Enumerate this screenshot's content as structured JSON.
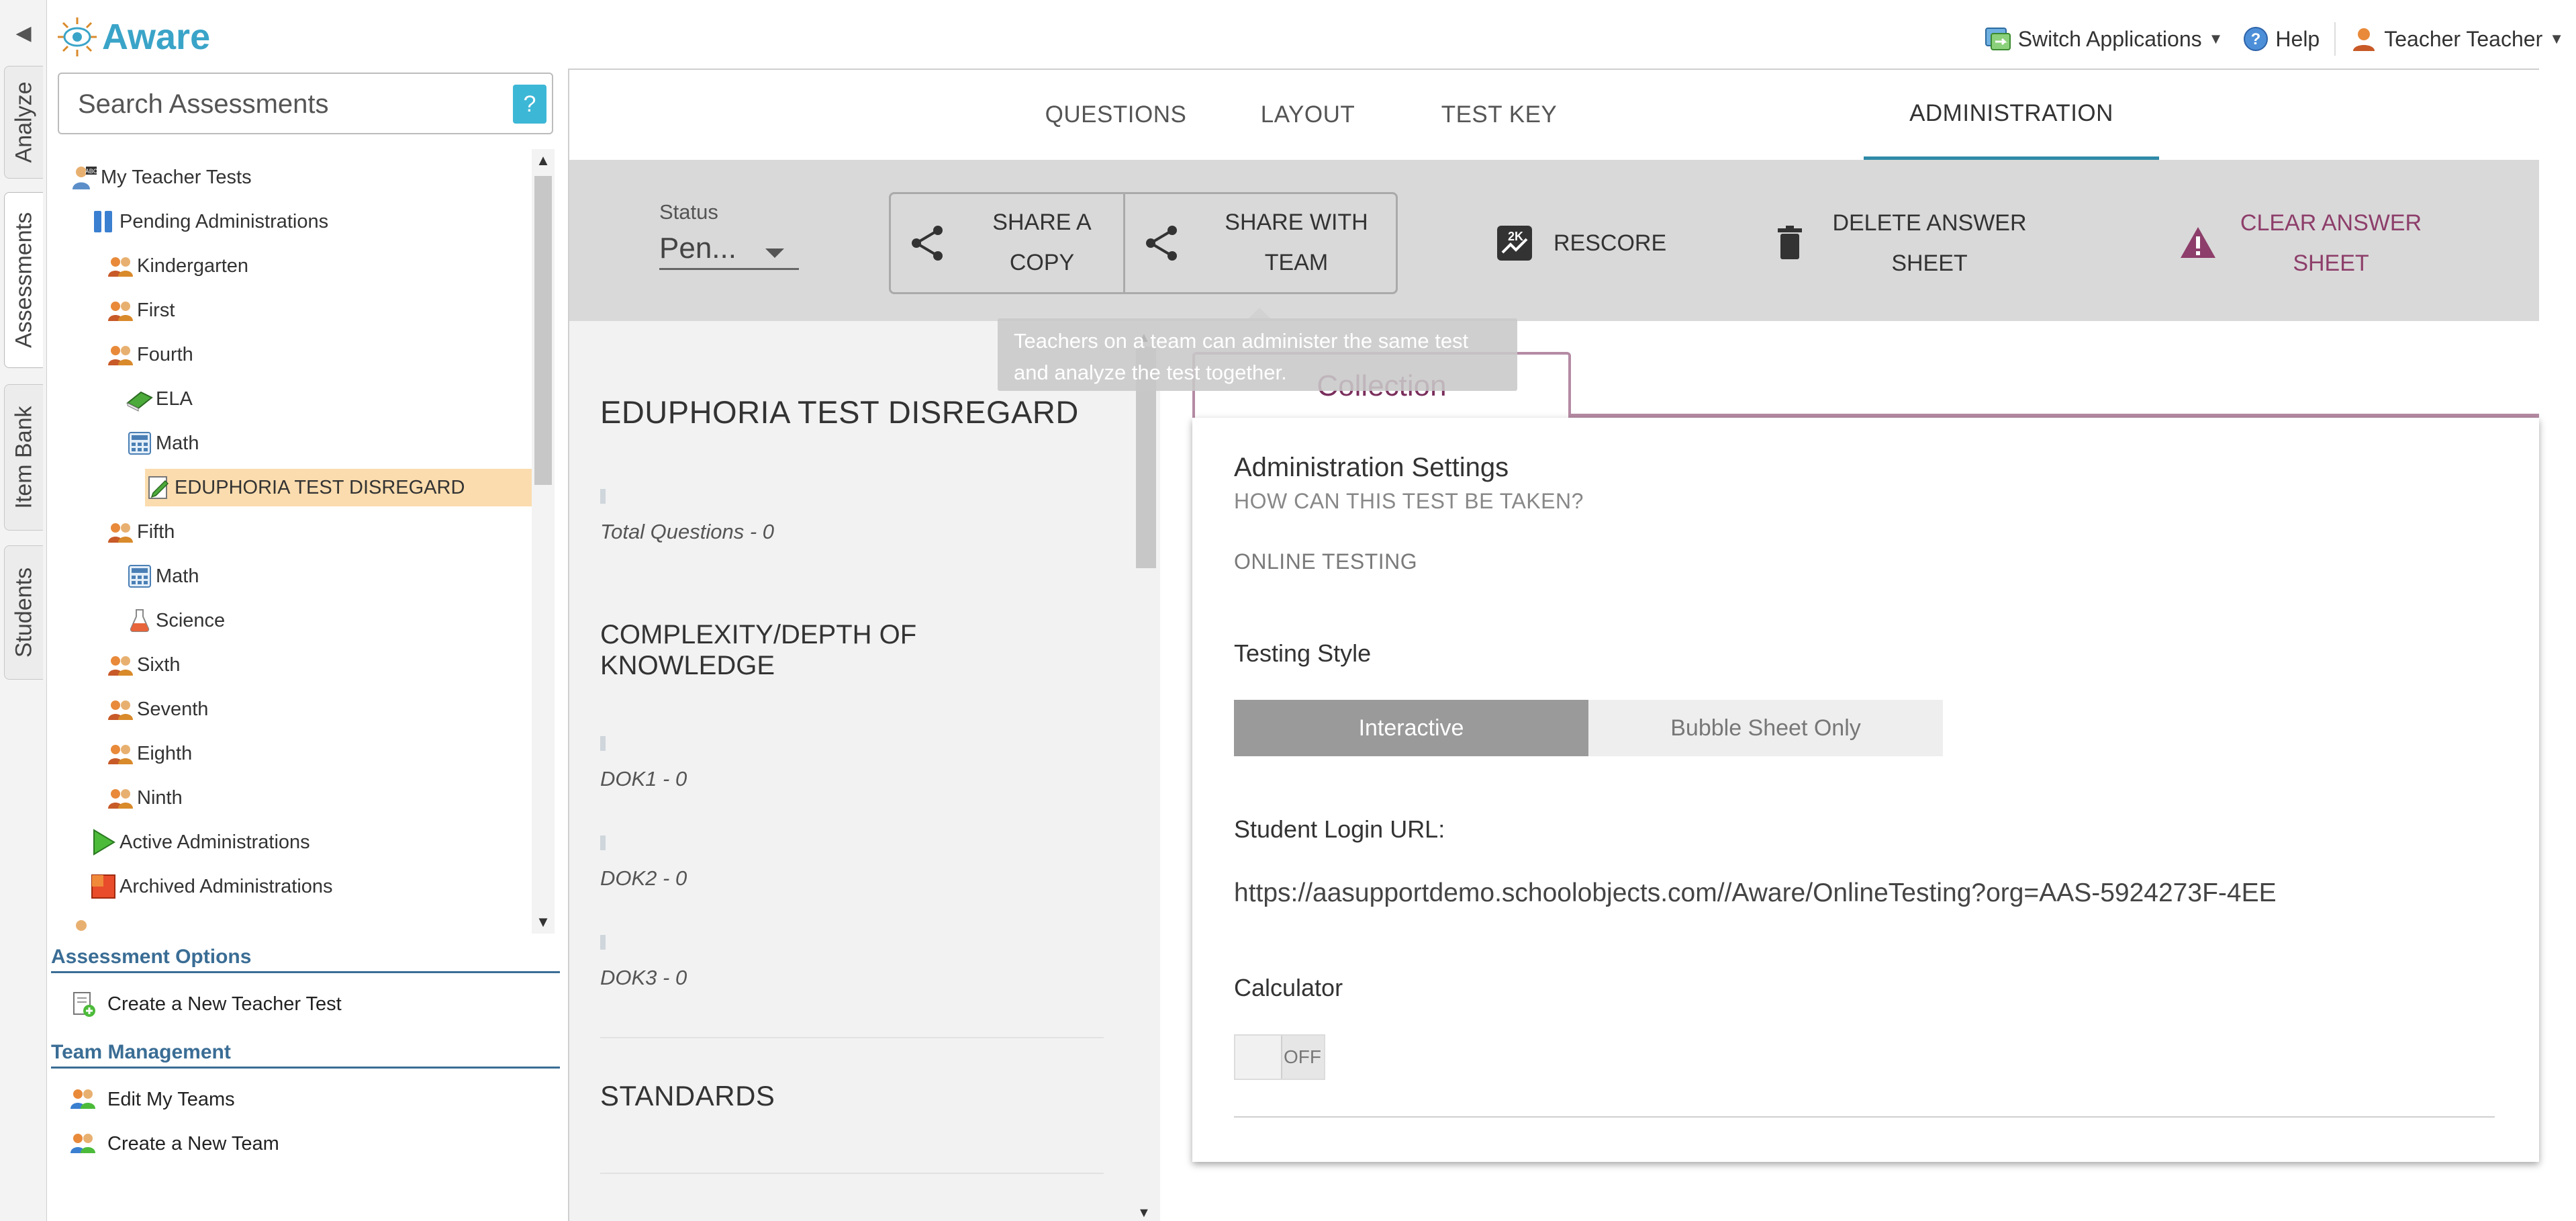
{
  "sidebar_tabs": [
    {
      "label": "Analyze"
    },
    {
      "label": "Assessments"
    },
    {
      "label": "Item Bank"
    },
    {
      "label": "Students"
    }
  ],
  "header": {
    "app_title": "Aware",
    "switch_apps": "Switch Applications",
    "help": "Help",
    "user": "Teacher Teacher"
  },
  "search": {
    "placeholder": "Search Assessments",
    "help_label": "?"
  },
  "tree": {
    "root": "My Teacher Tests",
    "pending": "Pending Administrations",
    "kindergarten": "Kindergarten",
    "first": "First",
    "fourth": "Fourth",
    "ela": "ELA",
    "math": "Math",
    "test": "EDUPHORIA TEST DISREGARD",
    "fifth": "Fifth",
    "math2": "Math",
    "science": "Science",
    "sixth": "Sixth",
    "seventh": "Seventh",
    "eighth": "Eighth",
    "ninth": "Ninth",
    "active": "Active Administrations",
    "archived": "Archived Administrations"
  },
  "assessment_options": {
    "title": "Assessment Options",
    "create_test": "Create a New Teacher Test"
  },
  "team_management": {
    "title": "Team Management",
    "edit_teams": "Edit My Teams",
    "create_team": "Create a New Team"
  },
  "tabs": {
    "questions": "QUESTIONS",
    "layout": "LAYOUT",
    "test_key": "TEST KEY",
    "administration": "ADMINISTRATION"
  },
  "toolbar": {
    "status_label": "Status",
    "status_value": "Pen...",
    "share_copy": "SHARE A COPY",
    "share_team": "SHARE WITH TEAM",
    "rescore": "RESCORE",
    "delete_sheet": "DELETE ANSWER SHEET",
    "clear_sheet": "CLEAR ANSWER SHEET"
  },
  "tooltip": "Teachers on a team can administer the same test and analyze the test together.",
  "summary": {
    "title": "EDUPHORIA TEST DISREGARD",
    "total_questions": "Total Questions - 0",
    "dok_title": "COMPLEXITY/DEPTH OF KNOWLEDGE",
    "dok1": "DOK1 - 0",
    "dok2": "DOK2 - 0",
    "dok3": "DOK3 - 0",
    "standards": "STANDARDS"
  },
  "collection": {
    "tab_label": "Collection",
    "settings_title": "Administration Settings",
    "settings_subtitle": "HOW CAN THIS TEST BE TAKEN?",
    "mode": "ONLINE TESTING",
    "testing_style_label": "Testing Style",
    "style_interactive": "Interactive",
    "style_bubble": "Bubble Sheet Only",
    "login_url_label": "Student Login URL:",
    "login_url": "https://aasupportdemo.schoolobjects.com//Aware/OnlineTesting?org=AAS-5924273F-4EE",
    "calculator_label": "Calculator",
    "calculator_state": "OFF"
  },
  "colors": {
    "brand": "#3aa4c8",
    "accent_tab": "#2f8aa8",
    "collection": "#7a2e5c",
    "selected_row": "#fbdcae",
    "section_title": "#3a6d95"
  }
}
